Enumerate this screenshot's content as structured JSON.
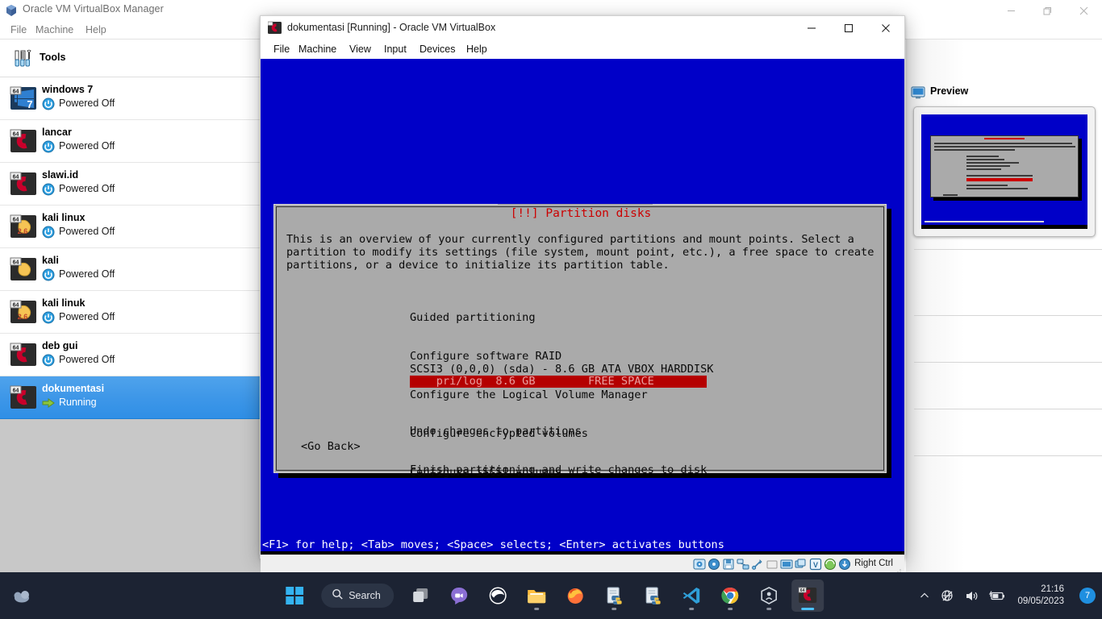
{
  "manager": {
    "title": "Oracle VM VirtualBox Manager",
    "title_icon": "virtualbox-box-icon",
    "menu": [
      "File",
      "Machine",
      "Help"
    ],
    "window_controls": [
      "minimize",
      "restore",
      "close"
    ],
    "tools_label": "Tools",
    "vm_list": [
      {
        "name": "windows 7",
        "state": "Powered Off",
        "icon": "windows7-64-icon",
        "selected": false
      },
      {
        "name": "lancar",
        "state": "Powered Off",
        "icon": "debian-64-icon",
        "selected": false
      },
      {
        "name": "slawi.id",
        "state": "Powered Off",
        "icon": "debian-64-icon",
        "selected": false
      },
      {
        "name": "kali linux",
        "state": "Powered Off",
        "icon": "linux26-64-icon",
        "selected": false
      },
      {
        "name": "kali",
        "state": "Powered Off",
        "icon": "linux-other-64-icon",
        "selected": false
      },
      {
        "name": "kali linuk",
        "state": "Powered Off",
        "icon": "linux26-64-icon",
        "selected": false
      },
      {
        "name": "deb gui",
        "state": "Powered Off",
        "icon": "debian-64-icon",
        "selected": false
      },
      {
        "name": "dokumentasi",
        "state": "Running",
        "icon": "debian-64-icon",
        "selected": true
      }
    ],
    "preview": {
      "label": "Preview",
      "icon": "monitor-icon"
    }
  },
  "vm_window": {
    "title": "dokumentasi [Running] - Oracle VM VirtualBox",
    "title_icon": "debian-vm-icon",
    "menu": [
      "File",
      "Machine",
      "View",
      "Input",
      "Devices",
      "Help"
    ],
    "window_controls": [
      "minimize",
      "maximize",
      "close"
    ],
    "statusbar": {
      "host_key": "Right Ctrl",
      "icons": [
        "hard-disk-icon",
        "optical-disk-icon",
        "floppy-disk-icon",
        "network-icon",
        "usb-icon",
        "shared-folder-icon",
        "display-icon",
        "recording-icon",
        "virtualization-icon",
        "mouse-integration-icon",
        "keyboard-capture-icon"
      ]
    }
  },
  "installer": {
    "title": "[!!] Partition disks",
    "description": "This is an overview of your currently configured partitions and mount points. Select a\npartition to modify its settings (file system, mount point, etc.), a free space to create\npartitions, or a device to initialize its partition table.",
    "menu_items": [
      "Guided partitioning",
      "Configure software RAID",
      "Configure the Logical Volume Manager",
      "Configure encrypted volumes",
      "Configure iSCSI volumes"
    ],
    "disk_header": "SCSI3 (0,0,0) (sda) - 8.6 GB ATA VBOX HARDDISK",
    "free_space_row": "    pri/log  8.6 GB        FREE SPACE",
    "actions": [
      "Undo changes to partitions",
      "Finish partitioning and write changes to disk"
    ],
    "go_back_button": "<Go Back>",
    "help_bar": "<F1> for help; <Tab> moves; <Space> selects; <Enter> activates buttons",
    "colors": {
      "dialog_bg": "#aaaaaa",
      "title_red": "#cc0000",
      "highlight_red": "#b50000",
      "screen_blue": "#0000c8"
    }
  },
  "taskbar": {
    "search_placeholder": "Search",
    "items": [
      "start-windows-icon",
      "task-view-icon",
      "chat-teams-icon",
      "edge-browser-icon",
      "file-explorer-icon",
      "firefox-icon",
      "python-file-icon",
      "python-file-icon",
      "vscode-icon",
      "chrome-icon",
      "virtualbox-icon",
      "virtualbox-vm-icon"
    ],
    "tray": {
      "chevron": "chevron-up-icon",
      "network": "network-globe-icon",
      "volume": "speaker-icon",
      "battery": "battery-charging-icon",
      "time": "21:16",
      "date": "09/05/2023",
      "notification_count": "7"
    }
  }
}
